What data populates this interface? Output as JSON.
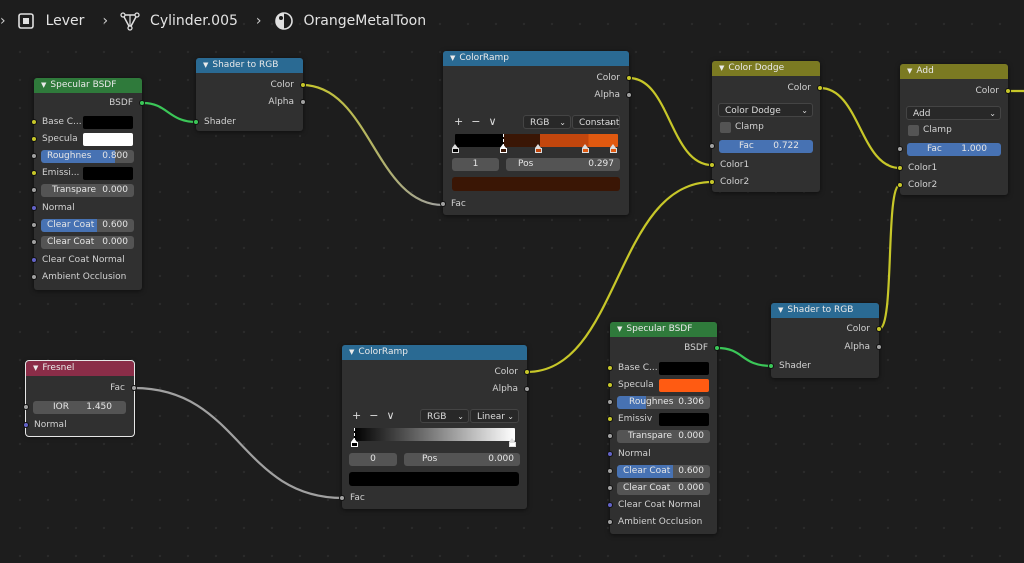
{
  "breadcrumb": {
    "separator": "›",
    "items": [
      {
        "label": "Lever",
        "icon": "object-icon"
      },
      {
        "label": "Cylinder.005",
        "icon": "mesh-icon"
      },
      {
        "label": "OrangeMetalToon",
        "icon": "material-icon"
      }
    ]
  },
  "colors": {
    "shader_header": "#2f7a3b",
    "converter_header": "#2a6a93",
    "color_header": "#7b7a22",
    "input_header": "#8a2d48",
    "accent_blue": "#4772b3",
    "orange": "#ff5b12"
  },
  "ui": {
    "plus": "+",
    "minus": "−",
    "chevron": "∨",
    "dropdown_arrow": "⌄"
  },
  "nodes": {
    "specular1": {
      "title": "Specular BSDF",
      "output": "BSDF",
      "base_color_label": "Base C...",
      "base_color": "#000000",
      "specular_label": "Specula",
      "specular_color": "#ffffff",
      "roughness_label": "Roughnes",
      "roughness_value": "0.800",
      "emission_label": "Emissi...",
      "emission_color": "#000000",
      "transparency_label": "Transpare",
      "transparency_value": "0.000",
      "normal_label": "Normal",
      "clearcoat_label": "Clear Coat",
      "clearcoat_value": "0.600",
      "clearcoat_rough_label": "Clear Coat",
      "clearcoat_rough_value": "0.000",
      "clearcoat_normal_label": "Clear Coat Normal",
      "ao_label": "Ambient Occlusion"
    },
    "shader_to_rgb1": {
      "title": "Shader to RGB",
      "out_color": "Color",
      "out_alpha": "Alpha",
      "in_shader": "Shader"
    },
    "colorramp1": {
      "title": "ColorRamp",
      "out_color": "Color",
      "out_alpha": "Alpha",
      "color_mode": "RGB",
      "interpolation": "Constant",
      "active_index": "1",
      "pos_label": "Pos",
      "pos_value": "0.297",
      "active_color": "#3a1605",
      "in_fac": "Fac"
    },
    "color_dodge": {
      "title": "Color Dodge",
      "out_color": "Color",
      "blend_mode": "Color Dodge",
      "clamp_label": "Clamp",
      "fac_label": "Fac",
      "fac_value": "0.722",
      "in_color1": "Color1",
      "in_color2": "Color2"
    },
    "add": {
      "title": "Add",
      "out_color": "Color",
      "blend_mode": "Add",
      "clamp_label": "Clamp",
      "fac_label": "Fac",
      "fac_value": "1.000",
      "in_color1": "Color1",
      "in_color2": "Color2"
    },
    "fresnel": {
      "title": "Fresnel",
      "out_fac": "Fac",
      "ior_label": "IOR",
      "ior_value": "1.450",
      "normal_label": "Normal"
    },
    "colorramp2": {
      "title": "ColorRamp",
      "out_color": "Color",
      "out_alpha": "Alpha",
      "color_mode": "RGB",
      "interpolation": "Linear",
      "active_index": "0",
      "pos_label": "Pos",
      "pos_value": "0.000",
      "active_color": "#000000",
      "in_fac": "Fac"
    },
    "specular2": {
      "title": "Specular BSDF",
      "output": "BSDF",
      "base_color_label": "Base C...",
      "base_color": "#000000",
      "specular_label": "Specula",
      "specular_color": "#ff5b12",
      "roughness_label": "Roughnes",
      "roughness_value": "0.306",
      "emission_label": "Emissiv",
      "emission_color": "#000000",
      "transparency_label": "Transpare",
      "transparency_value": "0.000",
      "normal_label": "Normal",
      "clearcoat_label": "Clear Coat",
      "clearcoat_value": "0.600",
      "clearcoat_rough_label": "Clear Coat",
      "clearcoat_rough_value": "0.000",
      "clearcoat_normal_label": "Clear Coat Normal",
      "ao_label": "Ambient Occlusion"
    },
    "shader_to_rgb2": {
      "title": "Shader to RGB",
      "out_color": "Color",
      "out_alpha": "Alpha",
      "in_shader": "Shader"
    }
  }
}
